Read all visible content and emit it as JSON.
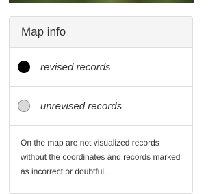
{
  "panel": {
    "title": "Map info",
    "legend": [
      {
        "label": "revised records",
        "marker": "filled-black-circle",
        "color": "#000000"
      },
      {
        "label": "unrevised records",
        "marker": "grey-circle",
        "color": "#d9d9d9"
      }
    ],
    "note": "On the map are not visualized records without the coordinates and records marked as incorrect or doubtful."
  }
}
